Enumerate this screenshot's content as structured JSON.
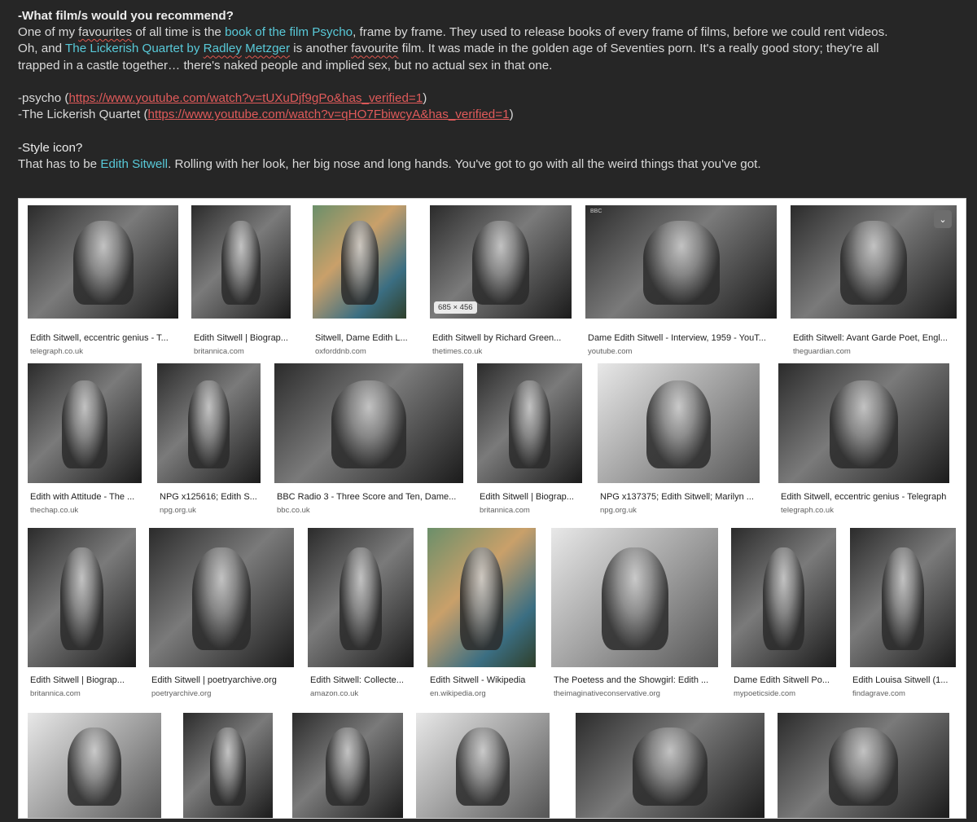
{
  "notes": {
    "q1": "-What film/s would you recommend?",
    "p1_a": "One of my ",
    "p1_b": "favourites",
    "p1_c": " of all time is the ",
    "p1_link": "book of the film Psycho",
    "p1_d": ", frame by frame. They used to release books of every frame of films, before we could rent videos.",
    "p2_a": "Oh, and ",
    "p2_link_a": "The Lickerish Quartet by ",
    "p2_link_b": "Radley",
    "p2_link_c": " ",
    "p2_link_d": "Metzger",
    "p2_b": " is another ",
    "p2_c": "favourite",
    "p2_d": " film. It was made in the golden age of Seventies porn. It's a really good story; they're all",
    "p3": "trapped in a castle together… there's naked people and implied sex, but no actual sex in that one.",
    "l1_a": "-psycho (",
    "l1_url": "https://www.youtube.com/watch?v=tUXuDjf9gPo&has_verified=1",
    "l1_b": ")",
    "l2_a": "-The Lickerish Quartet (",
    "l2_url": "https://www.youtube.com/watch?v=qHO7FbiwcyA&has_verified=1",
    "l2_b": ")",
    "q2": "-Style icon?",
    "p4_a": "That has to be ",
    "p4_link": "Edith Sitwell",
    "p4_b": ". Rolling with her look, her big nose and long hands. You've got to go with all the weird things that you've got."
  },
  "results": {
    "size_badge": "685 × 456",
    "expand_icon": "chevron-down-icon",
    "rows": [
      [
        {
          "title": "Edith Sitwell, eccentric genius - T...",
          "site": "telegraph.co.uk"
        },
        {
          "title": "Edith Sitwell | Biograp...",
          "site": "britannica.com"
        },
        {
          "title": "Sitwell, Dame Edith L...",
          "site": "oxforddnb.com"
        },
        {
          "title": "Edith Sitwell by Richard Green...",
          "site": "thetimes.co.uk"
        },
        {
          "title": "Dame Edith Sitwell - Interview, 1959 - YouT...",
          "site": "youtube.com",
          "tag": "BBC"
        },
        {
          "title": "Edith Sitwell: Avant Garde Poet, Engl...",
          "site": "theguardian.com"
        }
      ],
      [
        {
          "title": "Edith with Attitude - The ...",
          "site": "thechap.co.uk"
        },
        {
          "title": "NPG x125616; Edith S...",
          "site": "npg.org.uk"
        },
        {
          "title": "BBC Radio 3 - Three Score and Ten, Dame...",
          "site": "bbc.co.uk"
        },
        {
          "title": "Edith Sitwell | Biograp...",
          "site": "britannica.com"
        },
        {
          "title": "NPG x137375; Edith Sitwell; Marilyn ...",
          "site": "npg.org.uk"
        },
        {
          "title": "Edith Sitwell, eccentric genius - Telegraph",
          "site": "telegraph.co.uk"
        }
      ],
      [
        {
          "title": "Edith Sitwell | Biograp...",
          "site": "britannica.com"
        },
        {
          "title": "Edith Sitwell | poetryarchive.org",
          "site": "poetryarchive.org"
        },
        {
          "title": "Edith Sitwell: Collecte...",
          "site": "amazon.co.uk"
        },
        {
          "title": "Edith Sitwell - Wikipedia",
          "site": "en.wikipedia.org"
        },
        {
          "title": "The Poetess and the Showgirl: Edith ...",
          "site": "theimaginativeconservative.org"
        },
        {
          "title": "Dame Edith Sitwell Po...",
          "site": "mypoeticside.com"
        },
        {
          "title": "Edith Louisa Sitwell (1...",
          "site": "findagrave.com"
        }
      ],
      [
        {
          "title": "",
          "site": ""
        },
        {
          "title": "",
          "site": ""
        },
        {
          "title": "",
          "site": ""
        },
        {
          "title": "",
          "site": ""
        },
        {
          "title": "",
          "site": ""
        },
        {
          "title": "",
          "site": ""
        }
      ]
    ]
  }
}
